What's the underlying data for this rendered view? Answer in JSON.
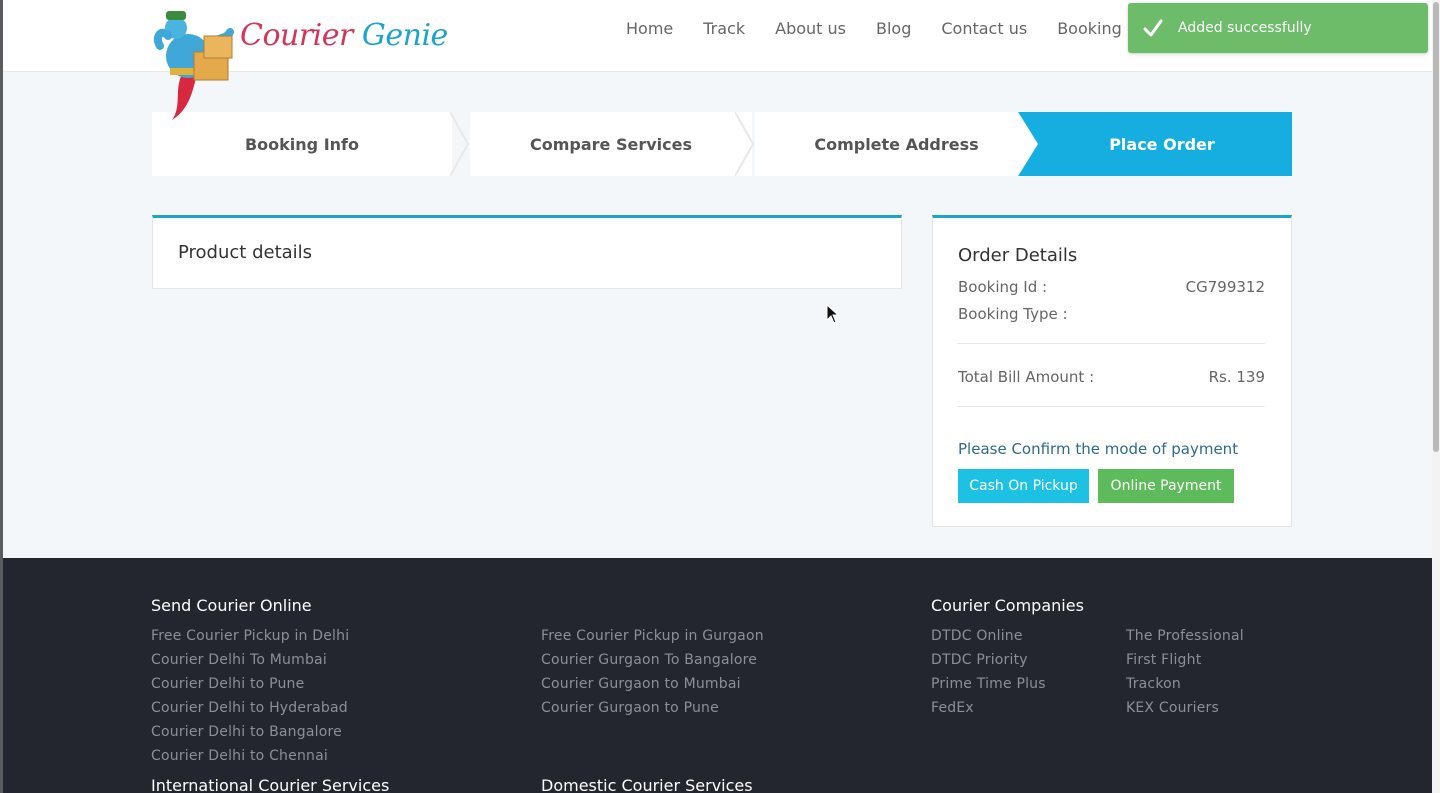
{
  "brand": {
    "part1": "Courier",
    "part2": "Genie"
  },
  "nav": [
    "Home",
    "Track",
    "About us",
    "Blog",
    "Contact us",
    "Booking"
  ],
  "toast": {
    "message": "Added successfully"
  },
  "steps": [
    {
      "label": "Booking Info",
      "active": false
    },
    {
      "label": "Compare Services",
      "active": false
    },
    {
      "label": "Complete Address",
      "active": false
    },
    {
      "label": "Place Order",
      "active": true
    }
  ],
  "product": {
    "title": "Product details"
  },
  "order": {
    "title": "Order Details",
    "booking_id_label": "Booking Id :",
    "booking_id": "CG799312",
    "booking_type_label": "Booking Type :",
    "booking_type": "",
    "total_label": "Total Bill Amount :",
    "total": "Rs. 139",
    "confirm_text": "Please Confirm the mode of payment",
    "cash_button": "Cash On Pickup",
    "online_button": "Online Payment"
  },
  "footer": {
    "send_title": "Send Courier Online",
    "send_links_a": [
      "Free Courier Pickup in Delhi",
      "Courier Delhi To Mumbai",
      "Courier Delhi to Pune",
      "Courier Delhi to Hyderabad",
      "Courier Delhi to Bangalore",
      "Courier Delhi to Chennai"
    ],
    "send_links_b": [
      "Free Courier Pickup in Gurgaon",
      "Courier Gurgaon To Bangalore",
      "Courier Gurgaon to Mumbai",
      "Courier Gurgaon to Pune"
    ],
    "companies_title": "Courier Companies",
    "companies_a": [
      "DTDC Online",
      "DTDC Priority",
      "Prime Time Plus",
      "FedEx"
    ],
    "companies_b": [
      "The Professional",
      "First Flight",
      "Trackon",
      "KEX Couriers"
    ],
    "intl_title": "International Courier Services",
    "domestic_title": "Domestic Courier Services"
  },
  "colors": {
    "accent": "#16aee0",
    "brand_red": "#d6355a",
    "brand_blue": "#1aa5c9",
    "success": "#6cbc6a",
    "footer_bg": "#24262f"
  }
}
